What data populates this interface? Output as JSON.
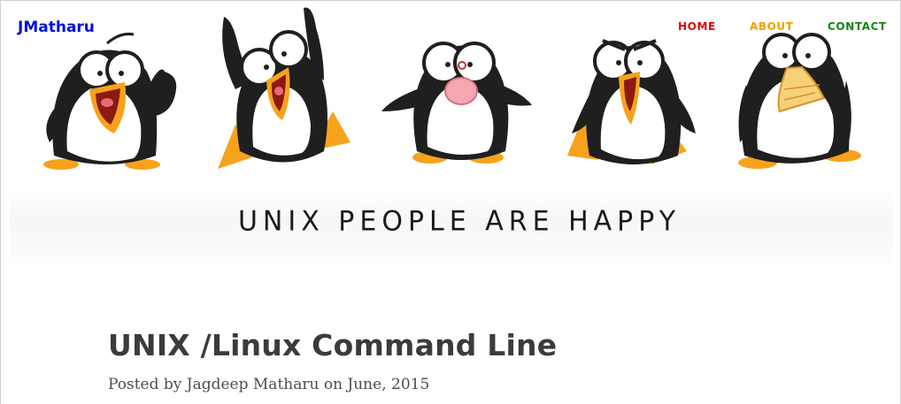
{
  "site": {
    "brand": "JMatharu"
  },
  "nav": {
    "home": "HOME",
    "about": "ABOUT",
    "contact": "CONTACT"
  },
  "hero": {
    "slogan": "UNIX PEOPLE ARE HAPPY",
    "colors": {
      "body": "#1a1a1a",
      "belly": "#ffffff",
      "feet": "#f7a21c",
      "mouth": "#c0392b"
    }
  },
  "post": {
    "title": "UNIX /Linux Command Line",
    "byline": "Posted by Jagdeep Matharu on June, 2015"
  }
}
